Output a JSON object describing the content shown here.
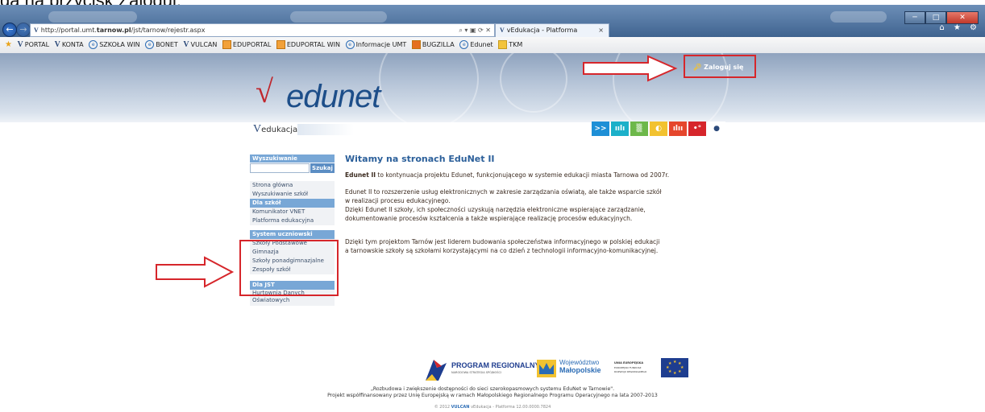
{
  "caption": "gą na przycisk Zaloguj.",
  "browser": {
    "url_prefix": "http://portal.umt.",
    "url_host": "tarnow.pl",
    "url_path": "/jst/tarnow/rejestr.aspx",
    "address_tools": "⌕ ▾ ▣ ⟳ ✕",
    "tab_title": "vEdukacja - Platforma",
    "tab_close": "×",
    "window_controls": [
      "─",
      "□",
      "✕"
    ],
    "right_icons": "⌂ ★ ⚙"
  },
  "favorites": [
    {
      "label": "PORTAL",
      "icon": "v-icon"
    },
    {
      "label": "KONTA",
      "icon": "v-icon"
    },
    {
      "label": "SZKOŁA WIN",
      "icon": "ie-icon"
    },
    {
      "label": "BONET",
      "icon": "ie-icon"
    },
    {
      "label": "VULCAN",
      "icon": "v-icon"
    },
    {
      "label": "EDUPORTAL",
      "icon": "square-icon"
    },
    {
      "label": "EDUPORTAL WIN",
      "icon": "square-icon"
    },
    {
      "label": "Informacje UMT",
      "icon": "ie-icon"
    },
    {
      "label": "BUGZILLA",
      "icon": "square-icon"
    },
    {
      "label": "Edunet",
      "icon": "ie-icon"
    },
    {
      "label": "TKM",
      "icon": "folder-icon"
    }
  ],
  "header": {
    "logo_text": "edunet",
    "login_label": "Zaloguj się"
  },
  "edubar": {
    "label": "edukacja",
    "icons": [
      ">>",
      "ıılı",
      "▒",
      "◐",
      "ılıı",
      "•°",
      "●"
    ]
  },
  "sidebar": {
    "search_title": "Wyszukiwanie",
    "search_button": "Szukaj",
    "search_value": "",
    "general_items": [
      "Strona główna",
      "Wyszukiwanie szkół"
    ],
    "schools_title": "Dla szkół",
    "schools_items": [
      "Komunikator VNET",
      "Platforma edukacyjna"
    ],
    "system_title": "System uczniowski",
    "system_items": [
      "Szkoły Podstawowe",
      "Gimnazja",
      "Szkoły ponadgimnazjalne",
      "Zespoły szkół"
    ],
    "jst_title": "Dla JST",
    "jst_items": [
      "Hurtownia Danych Oświatowych"
    ]
  },
  "main": {
    "title": "Witamy na stronach EduNet II",
    "para1_bold": "Edunet II",
    "para1_rest": " to kontynuacja projektu Edunet, funkcjonującego w systemie edukacji miasta Tarnowa od 2007r.",
    "para2_line1": "Edunet II to rozszerzenie usług elektronicznych w zakresie zarządzania oświatą, ale także wsparcie szkół",
    "para2_line2": "w realizacji procesu edukacyjnego.",
    "para2_line3": "Dzięki Edunet II szkoły, ich społeczności uzyskują narzędzia elektroniczne wspierające zarządzanie,",
    "para2_line4": "dokumentowanie procesów kształcenia a także wspierające realizację procesów edukacyjnych.",
    "para3_line1": "Dzięki tym projektom Tarnów jest liderem budowania społeczeństwa informacyjnego w polskiej edukacji",
    "para3_line2": "a tarnowskie szkoły są szkołami korzystającymi na co dzień z technologii informacyjno-komunikacyjnej."
  },
  "footer": {
    "program_title": "PROGRAM REGIONALNY",
    "program_sub": "NARODOWA STRATEGIA SPÓJNOŚCI",
    "region_line1": "Województwo",
    "region_line2": "Małopolskie",
    "eu_line1": "UNIA EUROPEJSKA",
    "eu_line2": "EUROPEJSKI FUNDUSZ",
    "eu_line3": "ROZWOJU REGIONALNEGO",
    "text_line1": "„Rozbudowa i zwiększenie dostępności do sieci szerokopasmowych systemu EduNet w Tarnowie\".",
    "text_line2": "Projekt współfinansowany przez Unię Europejską w ramach Małopolskiego Regionalnego Programu Operacyjnego na lata 2007-2013",
    "copy_prefix": "© 2012",
    "copy_brand": "VULCAN",
    "copy_rest": "vEdukacja - Platforma 12.00.0000.7824"
  },
  "colors": {
    "accent_red": "#d6262b",
    "sidebar_blue": "#78a7d6",
    "title_blue": "#2b5f9a"
  }
}
